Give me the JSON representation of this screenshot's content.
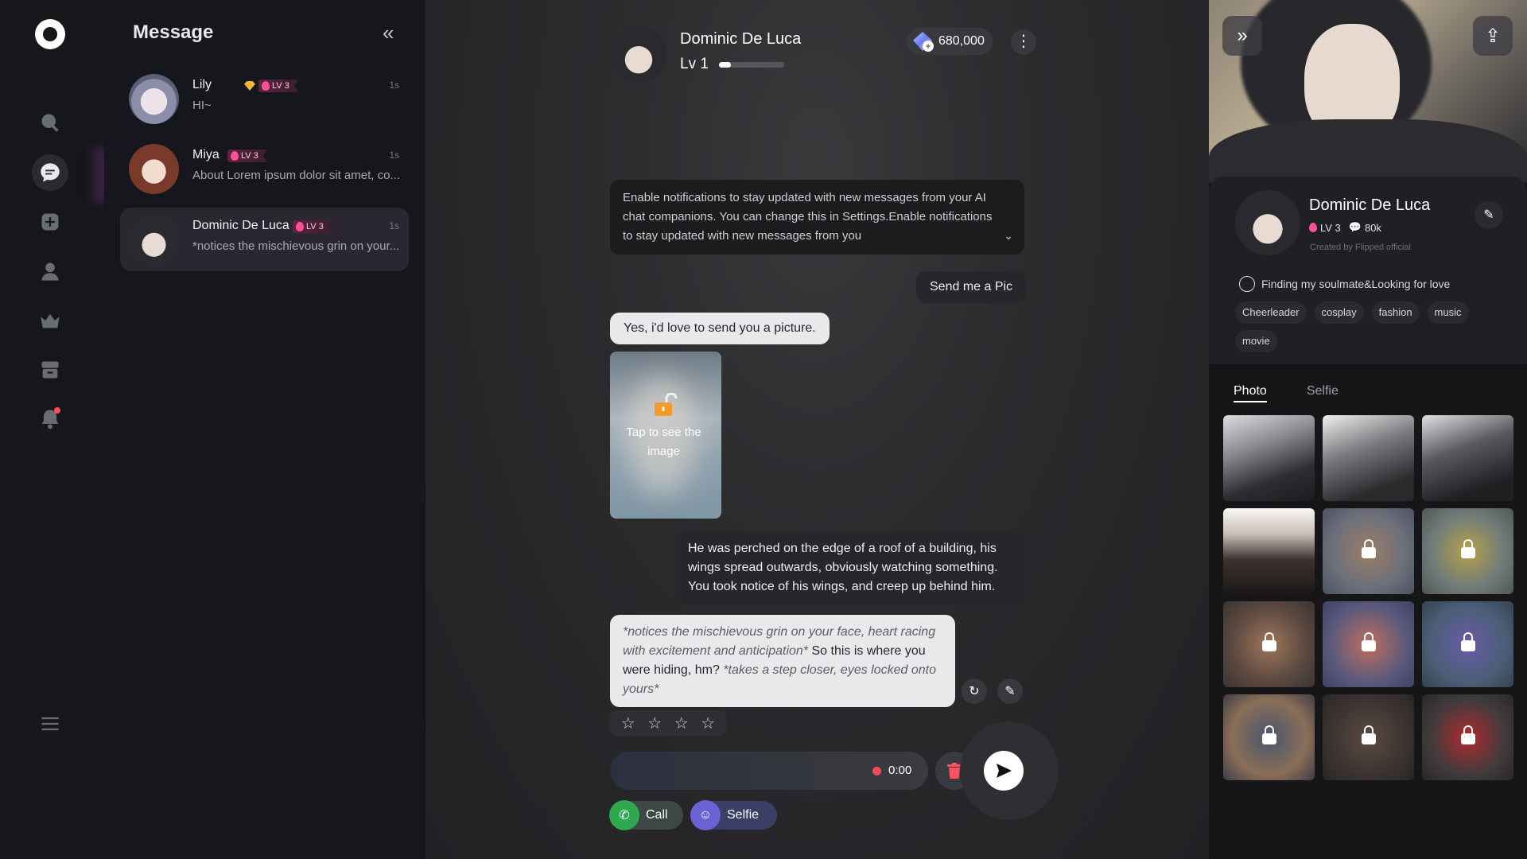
{
  "sidebar": {
    "title": "Message",
    "conversations": [
      {
        "name": "Lily",
        "level": "LV 3",
        "time": "1s",
        "preview": "HI~"
      },
      {
        "name": "Miya",
        "level": "LV 3",
        "time": "1s",
        "preview": "About Lorem ipsum dolor sit amet, co..."
      },
      {
        "name": "Dominic De Luca",
        "level": "LV 3",
        "time": "1s",
        "preview": "*notices the mischievous grin on your..."
      }
    ]
  },
  "chat": {
    "name": "Dominic De Luca",
    "level": "Lv 1",
    "level_progress": 0.18,
    "coins": "680,000",
    "notice": "Enable notifications to stay updated with new messages from your AI chat companions. You can change this in Settings.Enable notifications to stay updated with new messages from you",
    "messages": {
      "user_1": "Send me a Pic",
      "ai_1": "Yes, i'd love to send you a picture.",
      "image_locked_text": "Tap to see the image",
      "user_2": "He was perched on the edge of a roof of a building, his wings spread outwards, obviously watching something. You took notice of his wings, and creep up behind him.",
      "ai_2_action_1": "*notices the mischievous grin on your face, heart racing with excitement and anticipation*",
      "ai_2_speech": " So this is where you were hiding, hm? ",
      "ai_2_action_2": "*takes a step closer, eyes locked onto yours*"
    },
    "rating_stars": 4,
    "recording_time": "0:00",
    "call_label": "Call",
    "selfie_label": "Selfie"
  },
  "profile": {
    "name": "Dominic De Luca",
    "level": "LV 3",
    "chats": "80k",
    "creator": "Created by Flipped official",
    "status": "Finding my soulmate&Looking for love",
    "tags": [
      "Cheerleader",
      "cosplay",
      "fashion",
      "music",
      "movie"
    ],
    "tabs": [
      "Photo",
      "Selfie"
    ],
    "active_tab": "Photo"
  },
  "colors": {
    "accent_pink": "#ff4f9a",
    "call_green": "#2fa84f",
    "selfie_purple": "#6b62d6",
    "record_red": "#f24b5a"
  }
}
